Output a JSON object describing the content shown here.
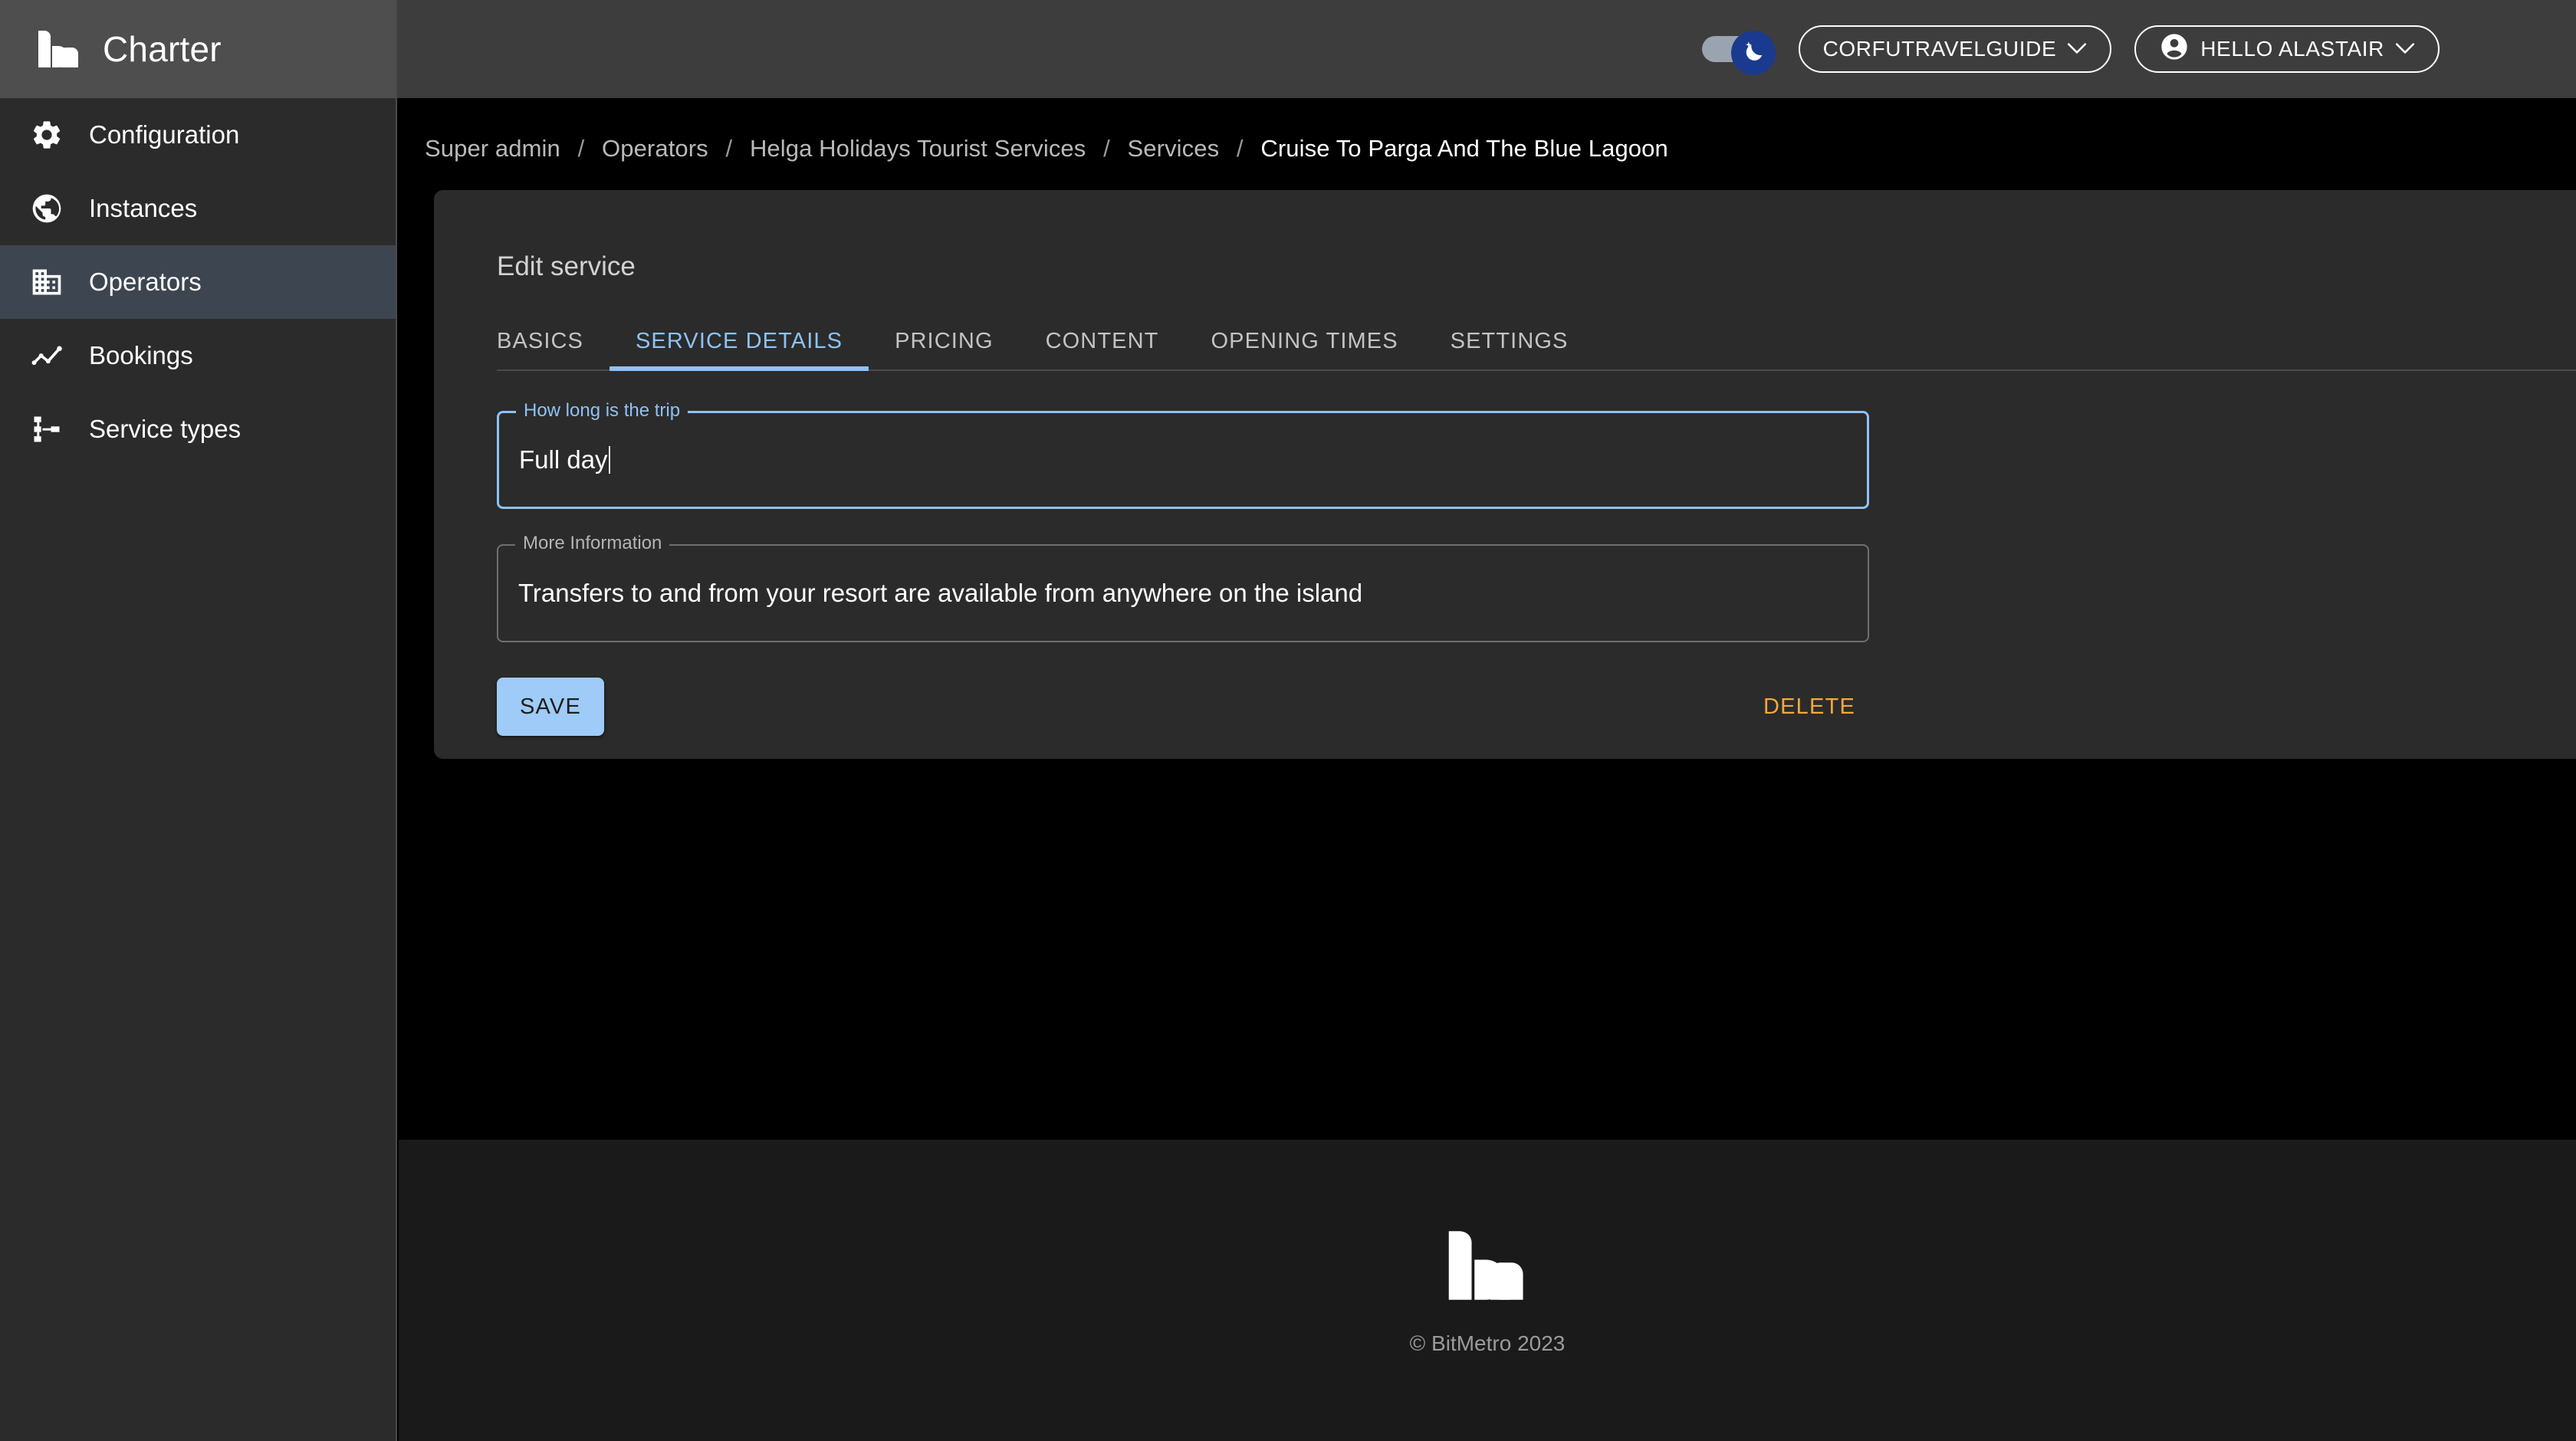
{
  "app": {
    "brand_title": "Charter",
    "brand_logo_icon": "bitmetro-logo-icon"
  },
  "sidebar": {
    "items": [
      {
        "label": "Configuration",
        "icon": "gear-icon",
        "active": false
      },
      {
        "label": "Instances",
        "icon": "globe-icon",
        "active": false
      },
      {
        "label": "Operators",
        "icon": "building-icon",
        "active": true
      },
      {
        "label": "Bookings",
        "icon": "line-chart-icon",
        "active": false
      },
      {
        "label": "Service types",
        "icon": "sitemap-icon",
        "active": false
      }
    ]
  },
  "topbar": {
    "theme_toggle": {
      "icon": "moon-star-icon",
      "state": "on",
      "track_color": "#9aa4b0",
      "knob_color": "#1a3a8f"
    },
    "instance_selector": {
      "label": "CORFUTRAVELGUIDE",
      "chevron": "⌄",
      "chevron_icon": "chevron-down-icon"
    },
    "user_menu": {
      "label": "HELLO ALASTAIR",
      "avatar_icon": "account-circle-icon",
      "chevron": "⌄",
      "chevron_icon": "chevron-down-icon"
    }
  },
  "breadcrumb": {
    "separator": "/",
    "items": [
      {
        "label": "Super admin",
        "current": false
      },
      {
        "label": "Operators",
        "current": false
      },
      {
        "label": "Helga Holidays Tourist Services",
        "current": false
      },
      {
        "label": "Services",
        "current": false
      },
      {
        "label": "Cruise To Parga And The Blue Lagoon",
        "current": true
      }
    ]
  },
  "card": {
    "title": "Edit service",
    "tabs": [
      {
        "label": "BASICS",
        "active": false
      },
      {
        "label": "SERVICE DETAILS",
        "active": true
      },
      {
        "label": "PRICING",
        "active": false
      },
      {
        "label": "CONTENT",
        "active": false
      },
      {
        "label": "OPENING TIMES",
        "active": false
      },
      {
        "label": "SETTINGS",
        "active": false
      }
    ],
    "fields": [
      {
        "legend": "How long is the trip",
        "value": "Full day",
        "placeholder": "",
        "focused": true
      },
      {
        "legend": "More Information",
        "value": "Transfers to and from your resort are available from anywhere on the island",
        "placeholder": "",
        "focused": false
      }
    ],
    "save_label": "SAVE",
    "delete_label": "DELETE"
  },
  "footer": {
    "logo_icon": "bitmetro-logo-icon",
    "copyright": "© BitMetro 2023"
  },
  "colors": {
    "accent_blue": "#8ec2f7",
    "save_button": "#9ecbf8",
    "delete_orange": "#f5a83c",
    "sidebar_bg": "#2b2b2b",
    "sidebar_header_bg": "#4e4e4e",
    "sidebar_active_bg": "#3d4650",
    "topbar_bg": "#3d3d3d",
    "content_bg": "#000000",
    "card_bg": "#2b2b2b",
    "footer_bg": "#1a1a1a"
  }
}
